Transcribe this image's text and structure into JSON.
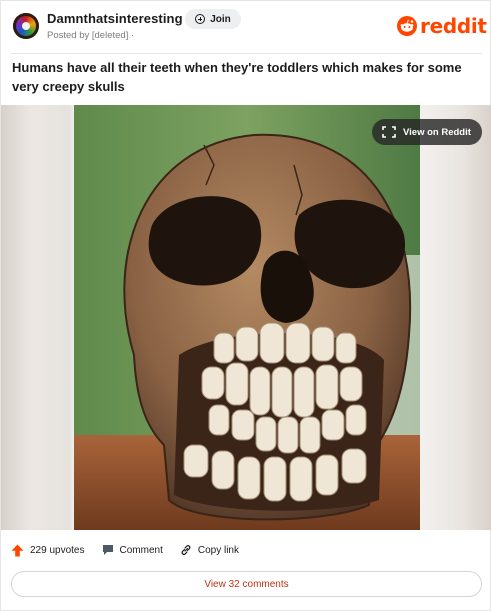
{
  "header": {
    "subreddit": "Damnthatsinteresting",
    "join_label": "Join",
    "posted_by": "Posted by [deleted] ·",
    "logo_text": "reddit",
    "brand_color": "#ff4500"
  },
  "post": {
    "title": "Humans have all their teeth when they're toddlers which makes for some very creepy skulls",
    "image_alt": "child skull showing baby and adult teeth",
    "view_on_reddit_label": "View on Reddit"
  },
  "actions": {
    "upvotes": "229 upvotes",
    "comment_label": "Comment",
    "copy_link_label": "Copy link"
  },
  "footer": {
    "view_comments_label": "View 32 comments"
  }
}
